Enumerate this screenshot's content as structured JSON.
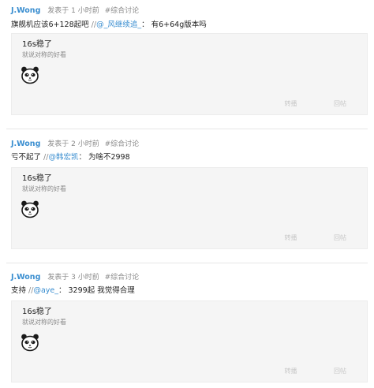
{
  "posts": [
    {
      "author": "J.Wong",
      "time": "发表于 1 小时前",
      "category": "#综合讨论",
      "content_text": "旗舰机应该6+128起吧",
      "slashes": " //",
      "mention": "@_风继续追_",
      "reply": "： 有6+64g版本吗",
      "quote_title": "16s稳了",
      "quote_sub": "就说对称的好看",
      "forward_label": "转播",
      "reply_label": "回帖"
    },
    {
      "author": "J.Wong",
      "time": "发表于 2 小时前",
      "category": "#综合讨论",
      "content_text": "亏不起了",
      "slashes": " //",
      "mention": "@韩宏凯",
      "reply": "： 为啥不2998",
      "quote_title": "16s稳了",
      "quote_sub": "就说对称的好看",
      "forward_label": "转播",
      "reply_label": "回帖"
    },
    {
      "author": "J.Wong",
      "time": "发表于 3 小时前",
      "category": "#综合讨论",
      "content_text": "支持",
      "slashes": " //",
      "mention": "@aye_",
      "reply": "： 3299起 我觉得合理",
      "quote_title": "16s稳了",
      "quote_sub": "就说对称的好看",
      "forward_label": "转播",
      "reply_label": "回帖"
    }
  ],
  "icons": {
    "emoji": "panda-face-icon"
  },
  "colors": {
    "link": "#3a8ed0",
    "muted": "#8a8a8a",
    "quote_bg": "#f5f5f5"
  }
}
